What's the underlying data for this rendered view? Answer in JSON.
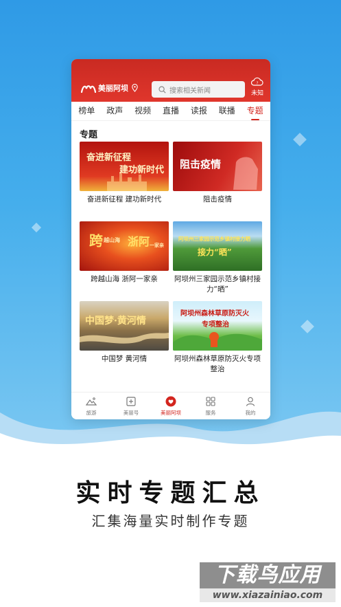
{
  "app": {
    "name": "美丽阿坝",
    "search_placeholder": "搜索相关新闻",
    "weather_text": "未知"
  },
  "tabs": [
    {
      "label": "榜单",
      "active": false
    },
    {
      "label": "政声",
      "active": false
    },
    {
      "label": "视频",
      "active": false
    },
    {
      "label": "直播",
      "active": false
    },
    {
      "label": "读报",
      "active": false
    },
    {
      "label": "联播",
      "active": false
    },
    {
      "label": "专题",
      "active": true
    }
  ],
  "section": {
    "title": "专题"
  },
  "topics": [
    {
      "caption": "奋进新征程 建功新时代",
      "thumb_text": [
        "奋进新征程",
        "建功新时代"
      ],
      "icon": "red-skyline-banner"
    },
    {
      "caption": "阻击疫情",
      "thumb_text": [
        "阻击疫情"
      ],
      "icon": "red-fist-banner"
    },
    {
      "caption": "跨越山海 浙阿一家亲",
      "thumb_text": [
        "跨",
        "越山海",
        "浙阿",
        "一家亲"
      ],
      "icon": "sunset-banner"
    },
    {
      "caption": "阿坝州三家园示范乡镇村接力“晒”",
      "thumb_text": [
        "阿坝州三家园示范乡镇村接力晒",
        "接力“晒”"
      ],
      "icon": "green-valley-banner"
    },
    {
      "caption": "中国梦 黄河情",
      "thumb_text": [
        "中国梦·黄河情"
      ],
      "icon": "river-banner"
    },
    {
      "caption": "阿坝州森林草原防灭火专项整治",
      "thumb_text": [
        "阿坝州森林草原防灭火",
        "专项整治"
      ],
      "icon": "firefighter-banner"
    }
  ],
  "bottom_nav": [
    {
      "label": "旅游",
      "icon": "mountain-icon",
      "active": false
    },
    {
      "label": "美丽号",
      "icon": "plus-square-icon",
      "active": false
    },
    {
      "label": "美丽阿坝",
      "icon": "heart-icon",
      "active": true
    },
    {
      "label": "服务",
      "icon": "grid-icon",
      "active": false
    },
    {
      "label": "我的",
      "icon": "user-icon",
      "active": false
    }
  ],
  "promo": {
    "headline": "实时专题汇总",
    "subline": "汇集海量实时制作专题"
  },
  "watermark": {
    "main": "下载鸟应用",
    "url": "www.xiazainiao.com"
  },
  "colors": {
    "brand_red": "#d3251e",
    "header_red": "#e0362c",
    "bg_blue": "#2f9ae6"
  }
}
